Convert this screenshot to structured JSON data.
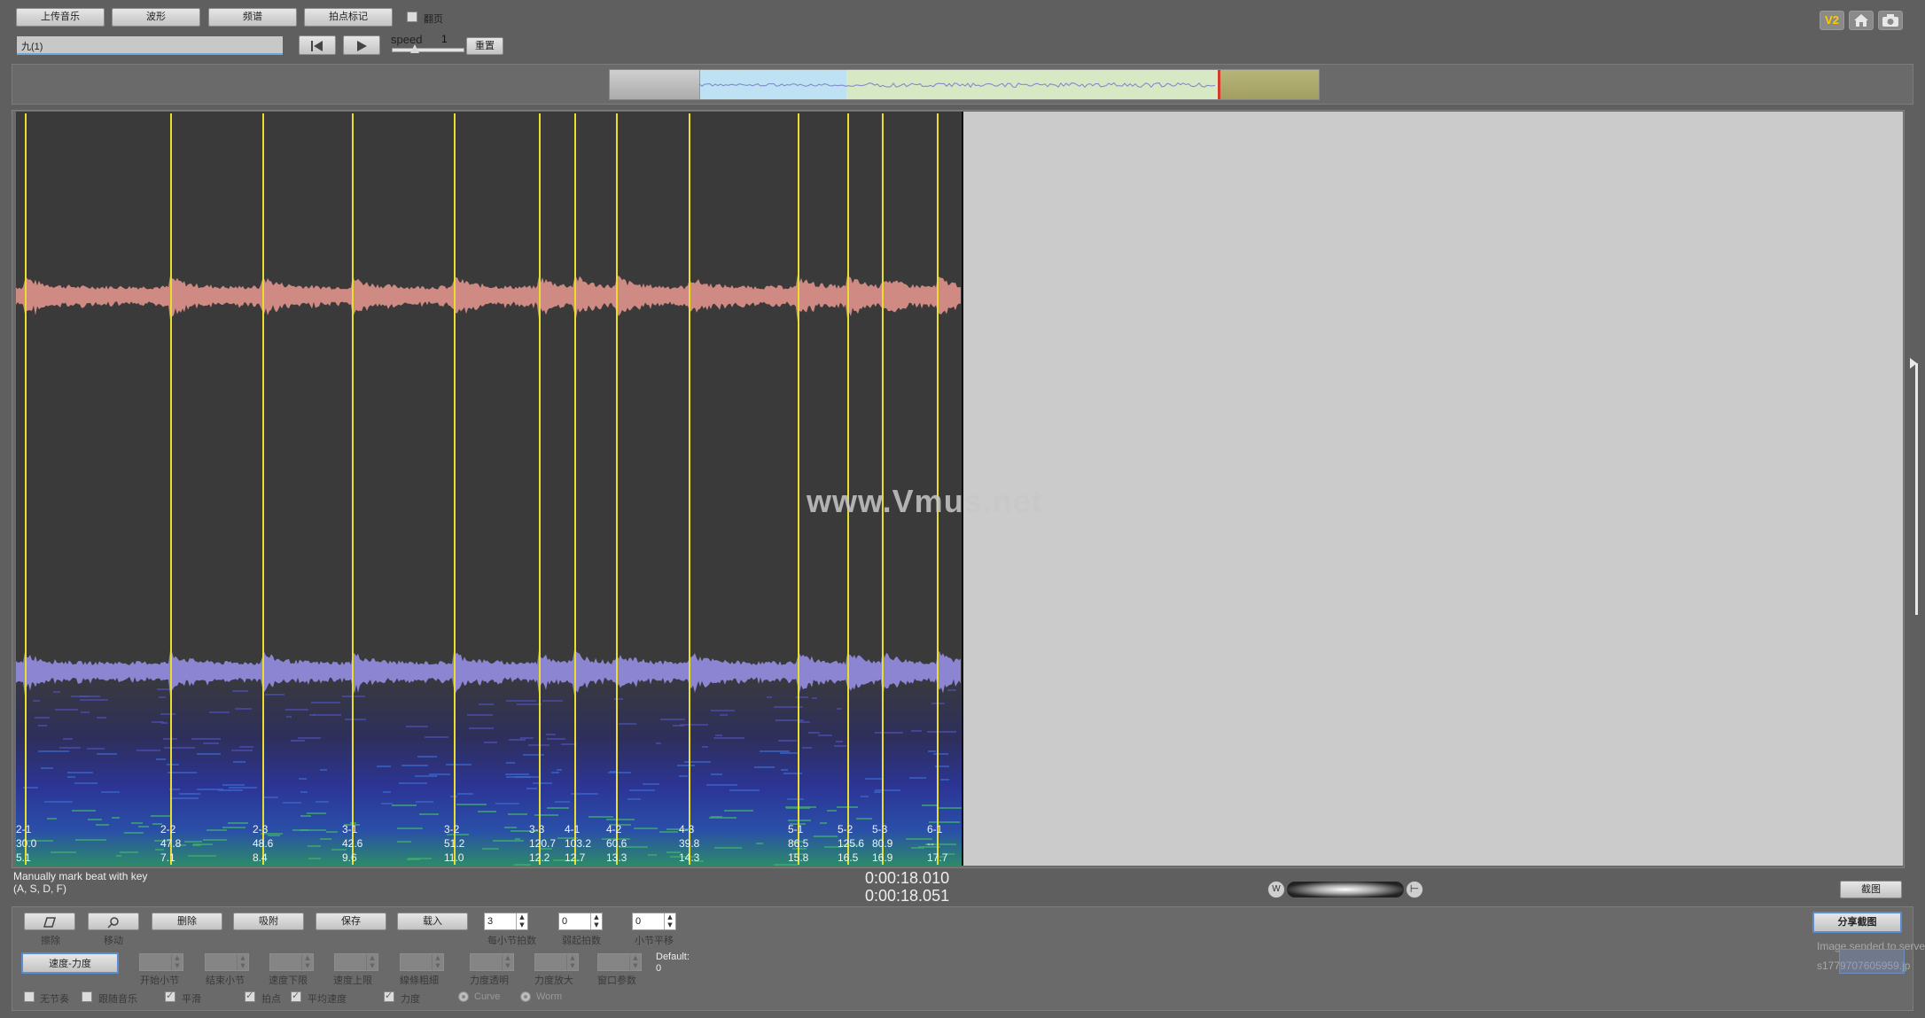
{
  "toolbar": {
    "upload_music": "上传音乐",
    "waveform": "波形",
    "spectrum": "频谱",
    "beat_mark": "拍点标记",
    "page_turn_label": "翻页",
    "song_name": "九(1)",
    "speed_label": "speed",
    "speed_value": "1",
    "reset": "重置",
    "first_icon": "skip-to-start-icon",
    "play_icon": "play-icon"
  },
  "top_right_icons": {
    "v2": "V2",
    "home": "home-icon",
    "camera": "camera-icon"
  },
  "watermark": "www.Vmus.net",
  "beats": [
    {
      "label": "2-1",
      "tempo": "30.0",
      "time": "5.1"
    },
    {
      "label": "2-2",
      "tempo": "47.8",
      "time": "7.1"
    },
    {
      "label": "2-3",
      "tempo": "48.6",
      "time": "8.4"
    },
    {
      "label": "3-1",
      "tempo": "42.6",
      "time": "9.6"
    },
    {
      "label": "3-2",
      "tempo": "51.2",
      "time": "11.0"
    },
    {
      "label": "3-3",
      "tempo": "120.7",
      "time": "12.2"
    },
    {
      "label": "4-1",
      "tempo": "103.2",
      "time": "12.7"
    },
    {
      "label": "4-2",
      "tempo": "60.6",
      "time": "13.3"
    },
    {
      "label": "4-3",
      "tempo": "39.8",
      "time": "14.3"
    },
    {
      "label": "5-1",
      "tempo": "86.5",
      "time": "15.8"
    },
    {
      "label": "5-2",
      "tempo": "125.6",
      "time": "16.5"
    },
    {
      "label": "5-3",
      "tempo": "80.9",
      "time": "16.9"
    },
    {
      "label": "6-1",
      "tempo": "--",
      "time": "17.7"
    }
  ],
  "status": {
    "hint_line1": "Manually mark beat with key",
    "hint_line2": "(A, S, D, F)",
    "time_current": "0:00:18.010",
    "time_total": "0:00:18.051",
    "screenshot_btn": "截图"
  },
  "controls": {
    "erase": "擦除",
    "move": "移动",
    "delete": "删除",
    "snap": "吸附",
    "save": "保存",
    "load": "载入",
    "beats_per_bar_value": "3",
    "beats_per_bar_label": "每小节拍数",
    "pickup_beats_value": "0",
    "pickup_beats_label": "弱起拍数",
    "bar_offset_value": "0",
    "bar_offset_label": "小节平移",
    "speed_force_tab": "速度-力度",
    "start_bar": "开始小节",
    "end_bar": "结束小节",
    "speed_lower": "速度下限",
    "speed_upper": "速度上限",
    "line_width": "線條粗細",
    "force_transparency": "力度透明",
    "force_zoom": "力度放大",
    "window_params": "窗口参数",
    "default_label": "Default:",
    "default_value": "0",
    "share_screenshot": "分享截图",
    "image_sent": "Image sended to serve",
    "share_id": "s1779707605959.jp",
    "opt_no_rhythm": "无节奏",
    "opt_follow_music": "跟随音乐",
    "opt_smooth": "平滑",
    "opt_beat": "拍点",
    "opt_avg_speed": "平均速度",
    "opt_force": "力度",
    "opt_curve": "Curve",
    "opt_worm": "Worm"
  },
  "colors": {
    "background": "#5f5f5f",
    "waveform_top": "#d08a84",
    "waveform_bottom": "#8b85d2",
    "beat_line": "#e9dd2e",
    "right_canvas": "#cbcbcb"
  }
}
